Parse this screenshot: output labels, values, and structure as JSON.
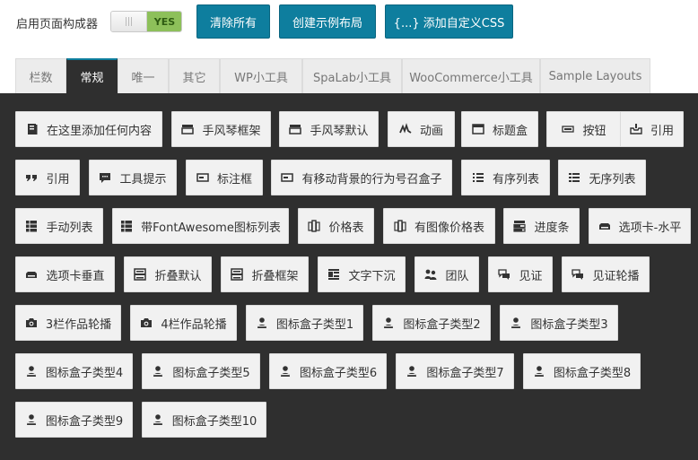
{
  "header": {
    "enable_label": "启用页面构成器",
    "toggle_value": "YES",
    "buttons": [
      "清除所有",
      "创建示例布局",
      "{...} 添加自定义CSS"
    ]
  },
  "tabs": [
    {
      "label": "栏数",
      "active": false
    },
    {
      "label": "常规",
      "active": true
    },
    {
      "label": "唯一",
      "active": false
    },
    {
      "label": "其它",
      "active": false
    },
    {
      "label": "WP小工具",
      "active": false
    },
    {
      "label": "SpaLab小工具",
      "active": false
    },
    {
      "label": "WooCommerce小工具",
      "active": false
    },
    {
      "label": "Sample Layouts",
      "active": false
    }
  ],
  "elements": [
    [
      {
        "label": "在这里添加任何内容",
        "icon": "book-icon"
      },
      {
        "label": "手风琴框架",
        "icon": "accordion-icon"
      },
      {
        "label": "手风琴默认",
        "icon": "accordion-icon"
      },
      {
        "label": "动画",
        "icon": "animation-icon"
      },
      {
        "label": "标题盒",
        "icon": "window-icon"
      },
      {
        "label": "按钮",
        "icon": "button-icon"
      },
      {
        "label": "引用",
        "icon": "inbox-icon"
      }
    ],
    [
      {
        "label": "引用",
        "icon": "quote-icon"
      },
      {
        "label": "工具提示",
        "icon": "comment-icon"
      },
      {
        "label": "标注框",
        "icon": "callout-icon"
      },
      {
        "label": "有移动背景的行为号召盒子",
        "icon": "callout-icon"
      },
      {
        "label": "有序列表",
        "icon": "ordered-list-icon"
      },
      {
        "label": "无序列表",
        "icon": "unordered-list-icon"
      }
    ],
    [
      {
        "label": "手动列表",
        "icon": "list-icon"
      },
      {
        "label": "带FontAwesome图标列表",
        "icon": "list-icon"
      },
      {
        "label": "价格表",
        "icon": "pricing-icon"
      },
      {
        "label": "有图像价格表",
        "icon": "pricing-icon"
      },
      {
        "label": "进度条",
        "icon": "progress-icon"
      },
      {
        "label": "选项卡-水平",
        "icon": "tab-icon"
      }
    ],
    [
      {
        "label": "选项卡垂直",
        "icon": "tab-icon"
      },
      {
        "label": "折叠默认",
        "icon": "toggle-icon"
      },
      {
        "label": "折叠框架",
        "icon": "toggle-icon"
      },
      {
        "label": "文字下沉",
        "icon": "dropcap-icon"
      },
      {
        "label": "团队",
        "icon": "team-icon"
      },
      {
        "label": "见证",
        "icon": "testimonial-icon"
      },
      {
        "label": "见证轮播",
        "icon": "testimonial-icon"
      }
    ],
    [
      {
        "label": "3栏作品轮播",
        "icon": "camera-icon"
      },
      {
        "label": "4栏作品轮播",
        "icon": "camera-icon"
      },
      {
        "label": "图标盒子类型1",
        "icon": "user-icon"
      },
      {
        "label": "图标盒子类型2",
        "icon": "user-icon"
      },
      {
        "label": "图标盒子类型3",
        "icon": "user-icon"
      }
    ],
    [
      {
        "label": "图标盒子类型4",
        "icon": "user-icon"
      },
      {
        "label": "图标盒子类型5",
        "icon": "user-icon"
      },
      {
        "label": "图标盒子类型6",
        "icon": "user-icon"
      },
      {
        "label": "图标盒子类型7",
        "icon": "user-icon"
      },
      {
        "label": "图标盒子类型8",
        "icon": "user-icon"
      }
    ],
    [
      {
        "label": "图标盒子类型9",
        "icon": "user-icon"
      },
      {
        "label": "图标盒子类型10",
        "icon": "user-icon"
      }
    ]
  ]
}
